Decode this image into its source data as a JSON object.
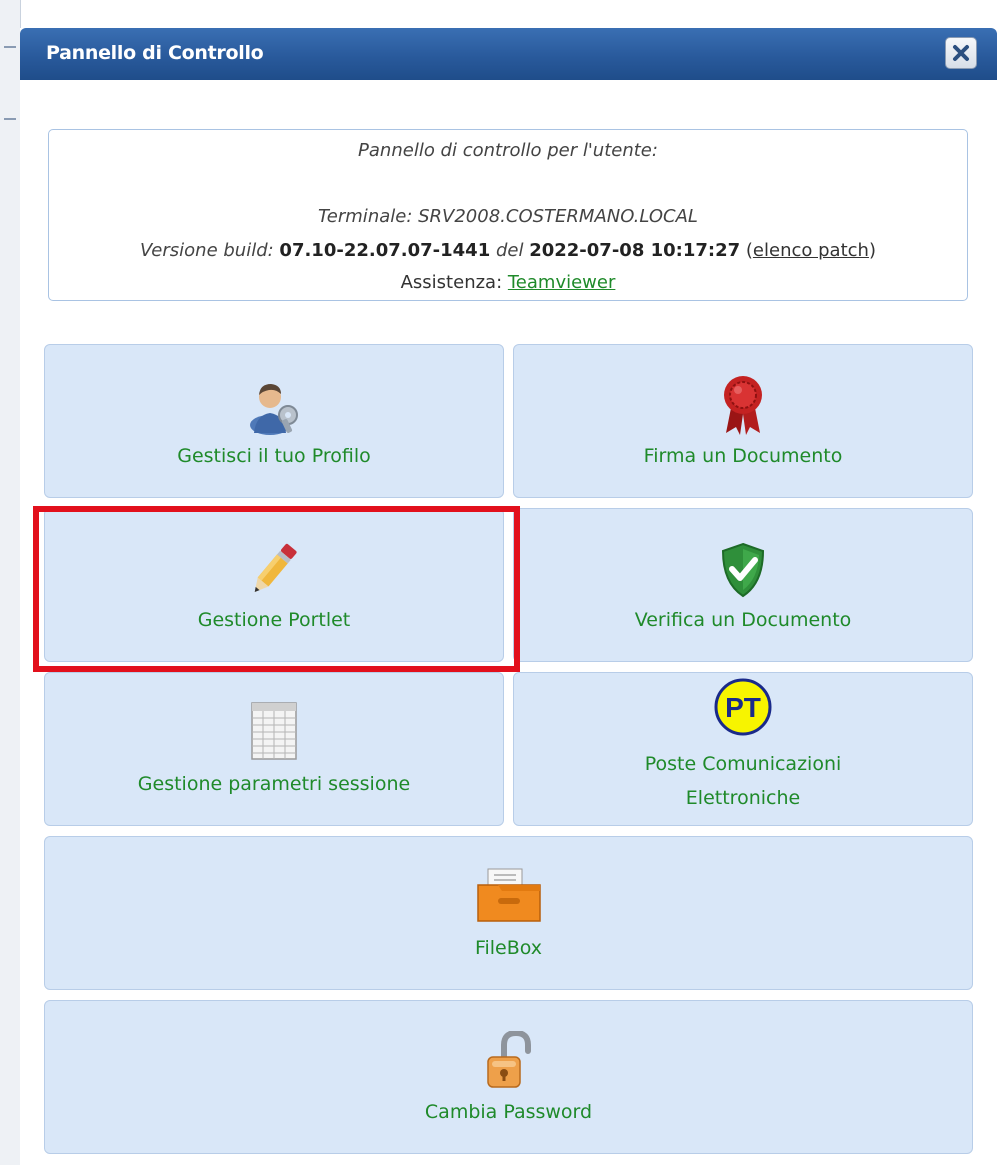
{
  "dialog": {
    "title": "Pannello di Controllo",
    "close_icon": "close-icon"
  },
  "info": {
    "user_line": "Pannello di controllo per l'utente:",
    "terminal_line": "Terminale: SRV2008.COSTERMANO.LOCAL",
    "build_label": "Versione build:",
    "build_value": "07.10-22.07.07-1441",
    "del_label": "del",
    "build_date": "2022-07-08 10:17:27",
    "patch_open": "(",
    "patch_link": "elenco patch",
    "patch_close": ")",
    "assist_label": "Assistenza:",
    "assist_link": "Teamviewer"
  },
  "tiles": [
    {
      "label": "Gestisci il tuo Profilo",
      "icon": "user-profile-icon"
    },
    {
      "label": "Firma un Documento",
      "icon": "seal-ribbon-icon"
    },
    {
      "label": "Gestione Portlet",
      "icon": "pencil-icon"
    },
    {
      "label": "Verifica un Documento",
      "icon": "shield-check-icon"
    },
    {
      "label": "Gestione parametri sessione",
      "icon": "spreadsheet-icon"
    },
    {
      "label_line1": "Poste Comunicazioni",
      "label_line2": "Elettroniche",
      "icon": "poste-pt-icon",
      "icon_text": "PT"
    },
    {
      "label": "FileBox",
      "icon": "filebox-icon"
    },
    {
      "label": "Cambia Password",
      "icon": "unlocked-padlock-icon"
    }
  ],
  "colors": {
    "titlebar": "#295a9c",
    "tile_bg": "#d9e7f8",
    "tile_label": "#1f8a2a",
    "highlight": "#e2101c"
  }
}
